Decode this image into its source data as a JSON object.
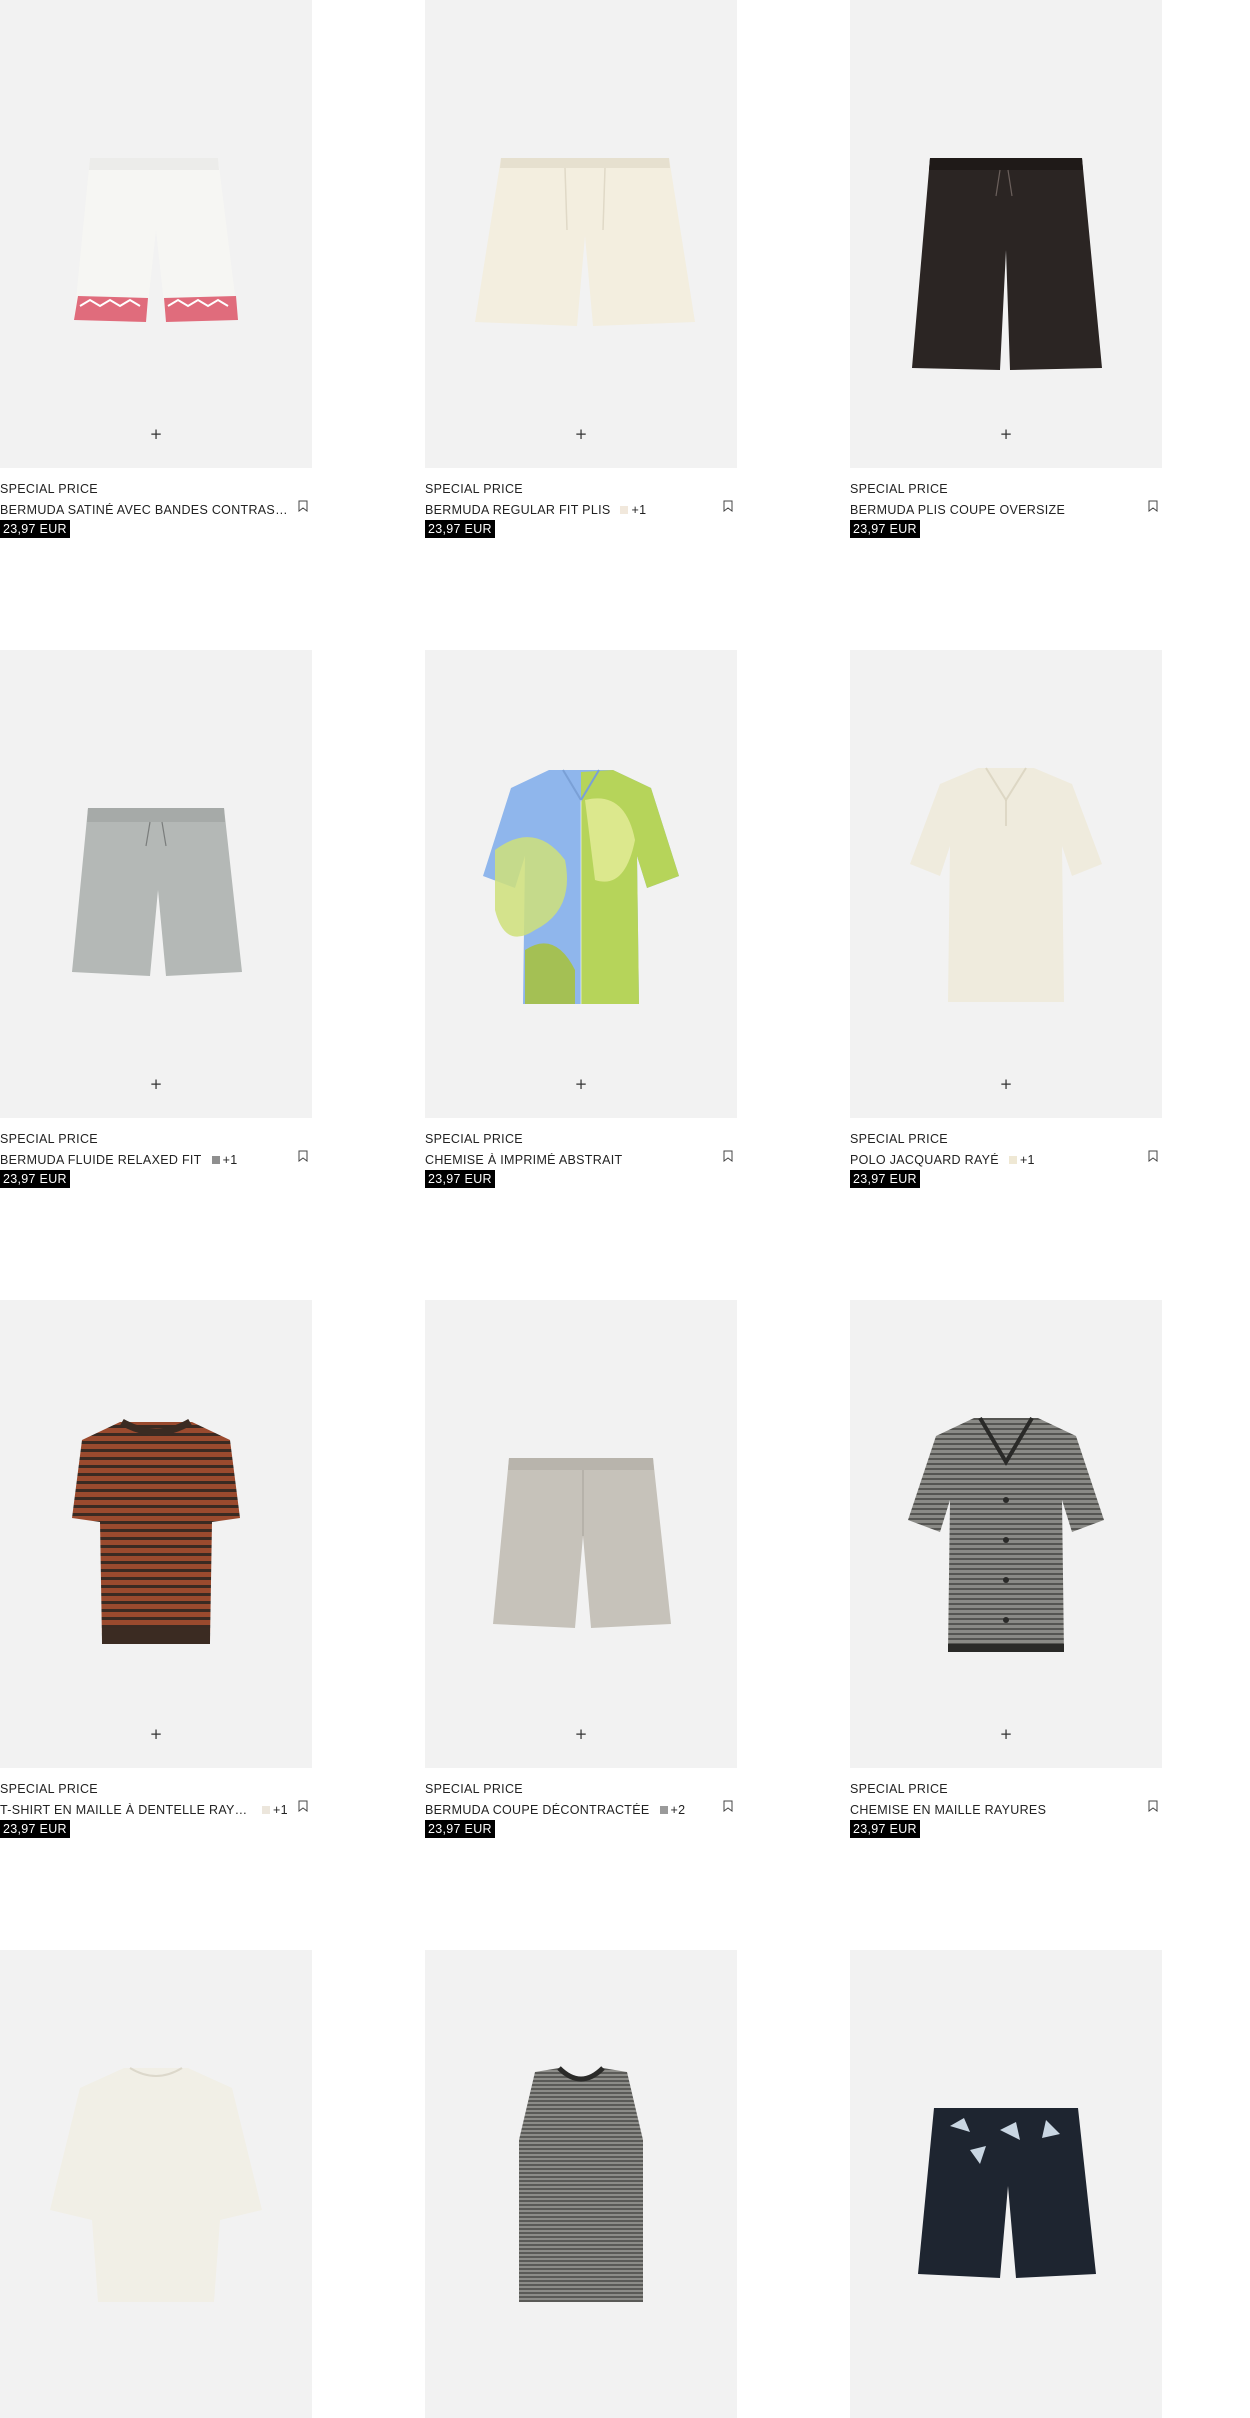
{
  "products": [
    {
      "tag": "SPECIAL PRICE",
      "name": "BERMUDA SATINÉ AVEC BANDES CONTRASTÉES",
      "colors_more": "",
      "swatch": "",
      "price": "23,97 EUR"
    },
    {
      "tag": "SPECIAL PRICE",
      "name": "BERMUDA REGULAR FIT PLIS",
      "colors_more": "+1",
      "swatch": "#f1e8dc",
      "price": "23,97 EUR"
    },
    {
      "tag": "SPECIAL PRICE",
      "name": "BERMUDA PLIS COUPE OVERSIZE",
      "colors_more": "",
      "swatch": "",
      "price": "23,97 EUR"
    },
    {
      "tag": "SPECIAL PRICE",
      "name": "BERMUDA FLUIDE RELAXED FIT",
      "colors_more": "+1",
      "swatch": "#8f8f8f",
      "price": "23,97 EUR"
    },
    {
      "tag": "SPECIAL PRICE",
      "name": "CHEMISE À IMPRIMÉ ABSTRAIT",
      "colors_more": "",
      "swatch": "",
      "price": "23,97 EUR"
    },
    {
      "tag": "SPECIAL PRICE",
      "name": "POLO JACQUARD RAYÉ",
      "colors_more": "+1",
      "swatch": "#efe8d4",
      "price": "23,97 EUR"
    },
    {
      "tag": "SPECIAL PRICE",
      "name": "T-SHIRT EN MAILLE À DENTELLE RAYURES",
      "colors_more": "+1",
      "swatch": "#ece6dc",
      "price": "23,97 EUR"
    },
    {
      "tag": "SPECIAL PRICE",
      "name": "BERMUDA COUPE DÉCONTRACTÉE",
      "colors_more": "+2",
      "swatch": "#9a9a9a",
      "price": "23,97 EUR"
    },
    {
      "tag": "SPECIAL PRICE",
      "name": "CHEMISE EN MAILLE RAYURES",
      "colors_more": "",
      "swatch": "",
      "price": "23,97 EUR"
    }
  ],
  "icons": {
    "add": "plus-icon",
    "save": "bookmark-icon"
  },
  "add_glyph": "+"
}
